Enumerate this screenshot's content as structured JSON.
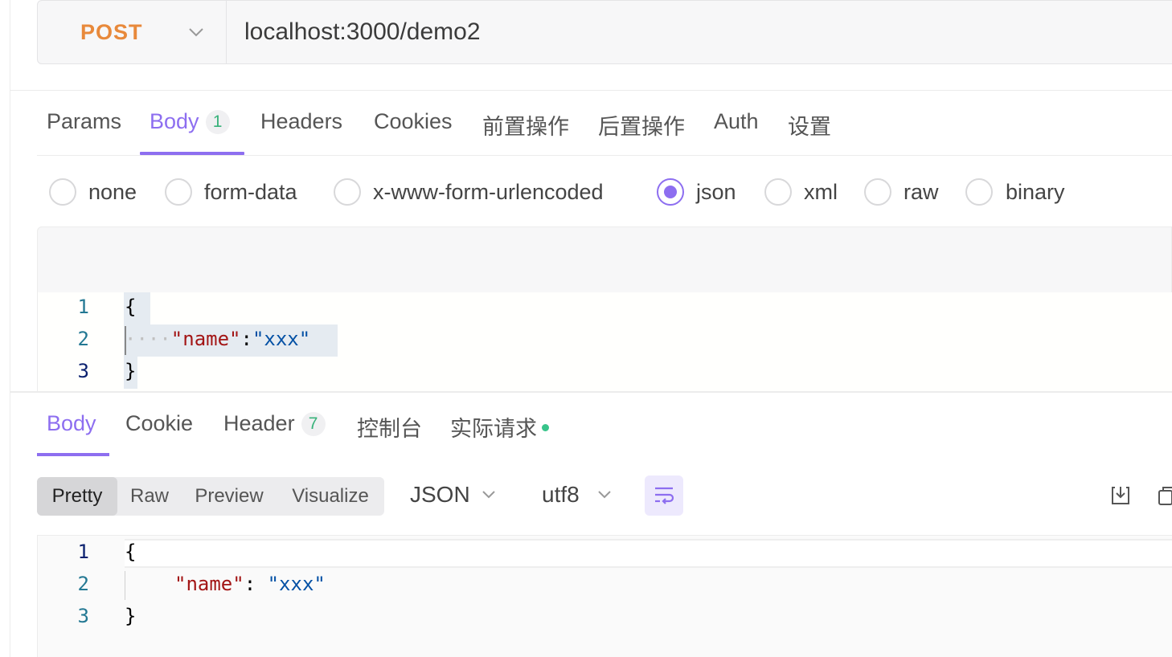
{
  "request": {
    "method": "POST",
    "url": "localhost:3000/demo2"
  },
  "request_tabs": [
    {
      "label": "Params"
    },
    {
      "label": "Body",
      "badge": "1"
    },
    {
      "label": "Headers"
    },
    {
      "label": "Cookies"
    },
    {
      "label": "前置操作"
    },
    {
      "label": "后置操作"
    },
    {
      "label": "Auth"
    },
    {
      "label": "设置"
    }
  ],
  "body_types": [
    {
      "label": "none",
      "checked": false
    },
    {
      "label": "form-data",
      "checked": false
    },
    {
      "label": "x-www-form-urlencoded",
      "checked": false
    },
    {
      "label": "json",
      "checked": true
    },
    {
      "label": "xml",
      "checked": false
    },
    {
      "label": "raw",
      "checked": false
    },
    {
      "label": "binary",
      "checked": false
    }
  ],
  "request_editor": {
    "line_numbers": [
      "1",
      "2",
      "3"
    ],
    "open_brace": "{",
    "indent_dots": "····",
    "key": "\"name\"",
    "colon": ":",
    "value": "\"xxx\"",
    "close_brace": "}"
  },
  "response_tabs": [
    {
      "label": "Body"
    },
    {
      "label": "Cookie"
    },
    {
      "label": "Header",
      "badge": "7"
    },
    {
      "label": "控制台"
    },
    {
      "label": "实际请求"
    }
  ],
  "view_modes": [
    "Pretty",
    "Raw",
    "Preview",
    "Visualize"
  ],
  "format_select": "JSON",
  "encoding_select": "utf8",
  "response_editor": {
    "line_numbers": [
      "1",
      "2",
      "3"
    ],
    "open_brace": "{",
    "key": "\"name\"",
    "colon": ": ",
    "value": "\"xxx\"",
    "close_brace": "}"
  },
  "colors": {
    "accent": "#8d6ef0",
    "method": "#e8893b",
    "badge_text": "#38b27a",
    "json_key": "#a31515",
    "json_value": "#0451a5"
  },
  "icons": [
    "chevron-down-icon",
    "wrap-lines-icon",
    "save-download-icon",
    "copy-icon"
  ]
}
